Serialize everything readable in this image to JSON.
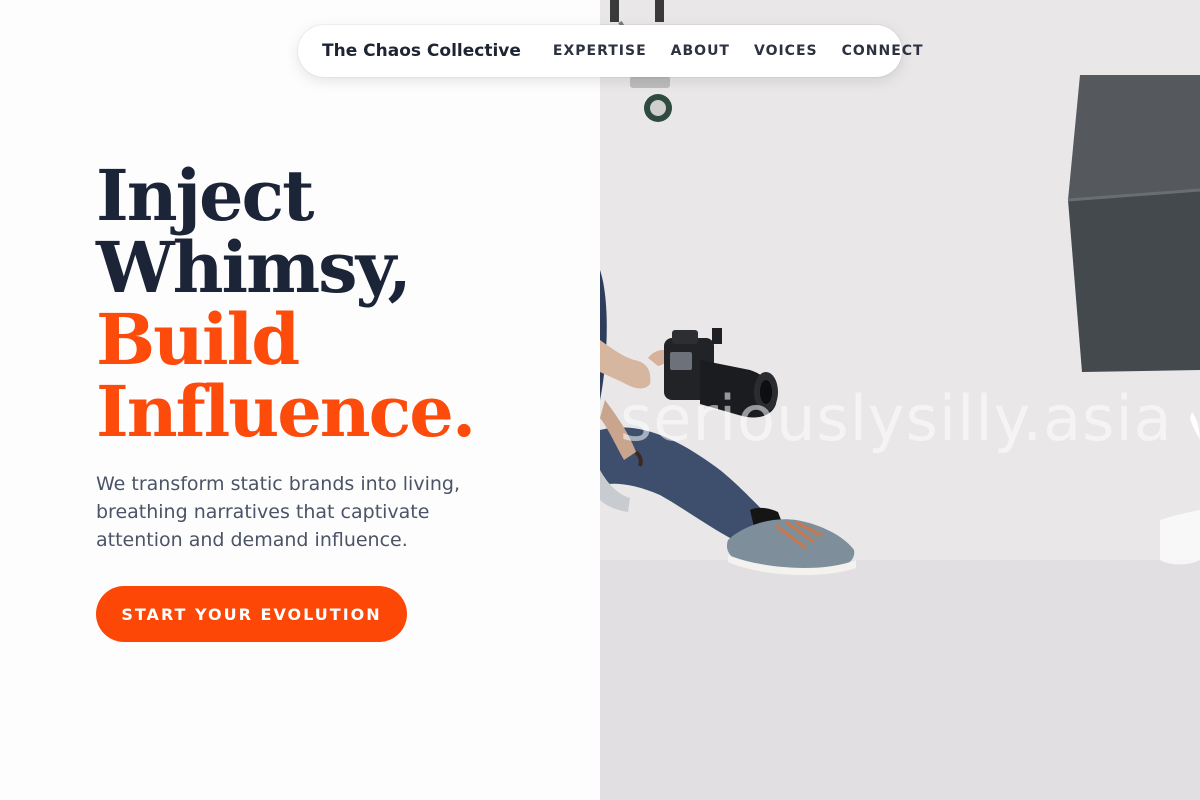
{
  "header": {
    "brand": "The Chaos Collective",
    "nav": [
      {
        "label": "EXPERTISE"
      },
      {
        "label": "ABOUT"
      },
      {
        "label": "VOICES"
      },
      {
        "label": "CONNECT"
      }
    ]
  },
  "hero": {
    "headline": {
      "line1": "Inject",
      "line2": "Whimsy,",
      "line3": "Build",
      "line4": "Influence."
    },
    "description": "We transform static brands into living, breathing narratives that captivate attention and demand influence.",
    "cta_label": "START YOUR EVOLUTION"
  },
  "image": {
    "watermark": "seriouslysilly.asia",
    "subject": "photographer-with-camera"
  },
  "colors": {
    "accent": "#fc4b0b",
    "heading": "#1c2538",
    "body_text": "#4b5466",
    "nav_text": "#2c3240"
  }
}
